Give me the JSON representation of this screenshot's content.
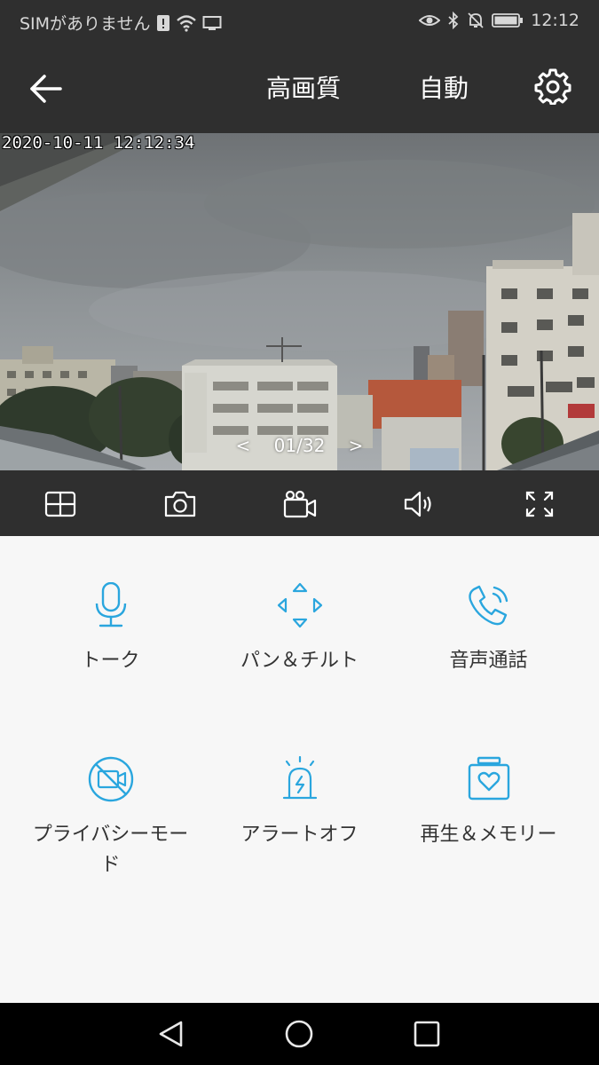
{
  "status_bar": {
    "carrier": "SIMがありません",
    "time": "12:12"
  },
  "app_bar": {
    "quality_label": "高画質",
    "mode_label": "自動"
  },
  "camera": {
    "timestamp": "2020-10-11 12:12:34",
    "pager": "01/32",
    "prev": "<",
    "next": ">"
  },
  "features": [
    {
      "label": "トーク",
      "icon": "microphone-icon"
    },
    {
      "label": "パン＆チルト",
      "icon": "pan-tilt-arrows-icon"
    },
    {
      "label": "音声通話",
      "icon": "phone-call-icon"
    },
    {
      "label": "プライバシーモード",
      "icon": "privacy-camera-off-icon"
    },
    {
      "label": "アラートオフ",
      "icon": "alarm-light-icon"
    },
    {
      "label": "再生＆メモリー",
      "icon": "memory-box-icon"
    }
  ],
  "colors": {
    "accent": "#2aa6de",
    "bar": "#2f2f2f",
    "background": "#f7f7f7"
  }
}
